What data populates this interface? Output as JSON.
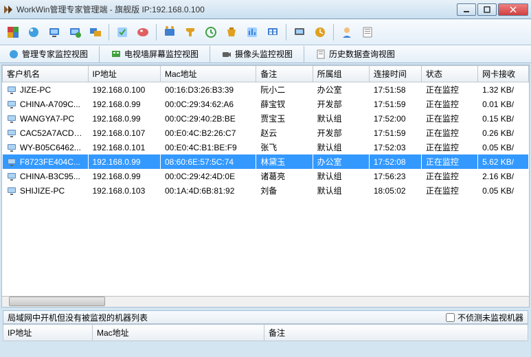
{
  "titlebar": {
    "text": "WorkWin管理专家管理端 - 旗舰版 IP:192.168.0.100"
  },
  "tabs": {
    "view_main": "管理专家监控视图",
    "view_wall": "电视墙屏幕监控视图",
    "view_cam": "摄像头监控视图",
    "view_history": "历史数据查询视图"
  },
  "columns": {
    "c0": "客户机名",
    "c1": "IP地址",
    "c2": "Mac地址",
    "c3": "备注",
    "c4": "所属组",
    "c5": "连接时间",
    "c6": "状态",
    "c7": "网卡接收"
  },
  "rows": [
    {
      "name": "JIZE-PC",
      "ip": "192.168.0.100",
      "mac": "00:16:D3:26:B3:39",
      "remark": "阮小二",
      "group": "办公室",
      "time": "17:51:58",
      "status": "正在监控",
      "rx": "1.32 KB/",
      "sel": false
    },
    {
      "name": "CHINA-A709C...",
      "ip": "192.168.0.99",
      "mac": "00:0C:29:34:62:A6",
      "remark": "薛宝钗",
      "group": "开发部",
      "time": "17:51:59",
      "status": "正在监控",
      "rx": "0.01 KB/",
      "sel": false
    },
    {
      "name": "WANGYA7-PC",
      "ip": "192.168.0.99",
      "mac": "00:0C:29:40:2B:BE",
      "remark": "贾宝玉",
      "group": "默认组",
      "time": "17:52:00",
      "status": "正在监控",
      "rx": "0.15 KB/",
      "sel": false
    },
    {
      "name": "CAC52A7ACD7...",
      "ip": "192.168.0.107",
      "mac": "00:E0:4C:B2:26:C7",
      "remark": "赵云",
      "group": "开发部",
      "time": "17:51:59",
      "status": "正在监控",
      "rx": "0.26 KB/",
      "sel": false
    },
    {
      "name": "WY-B05C6462...",
      "ip": "192.168.0.101",
      "mac": "00:E0:4C:B1:BE:F9",
      "remark": "张飞",
      "group": "默认组",
      "time": "17:52:03",
      "status": "正在监控",
      "rx": "0.05 KB/",
      "sel": false
    },
    {
      "name": "F8723FE404C...",
      "ip": "192.168.0.99",
      "mac": "08:60:6E:57:5C:74",
      "remark": "林黛玉",
      "group": "办公室",
      "time": "17:52:08",
      "status": "正在监控",
      "rx": "5.62 KB/",
      "sel": true
    },
    {
      "name": "CHINA-B3C95...",
      "ip": "192.168.0.99",
      "mac": "00:0C:29:42:4D:0E",
      "remark": "诸葛亮",
      "group": "默认组",
      "time": "17:56:23",
      "status": "正在监控",
      "rx": "2.16 KB/",
      "sel": false
    },
    {
      "name": "SHIJIZE-PC",
      "ip": "192.168.0.103",
      "mac": "00:1A:4D:6B:81:92",
      "remark": "刘备",
      "group": "默认组",
      "time": "18:05:02",
      "status": "正在监控",
      "rx": "0.05 KB/",
      "sel": false
    }
  ],
  "bottom": {
    "title": "局域网中开机但没有被监视的机器列表",
    "checkbox": "不侦测未监视机器",
    "h_ip": "IP地址",
    "h_mac": "Mac地址",
    "h_remark": "备注"
  }
}
